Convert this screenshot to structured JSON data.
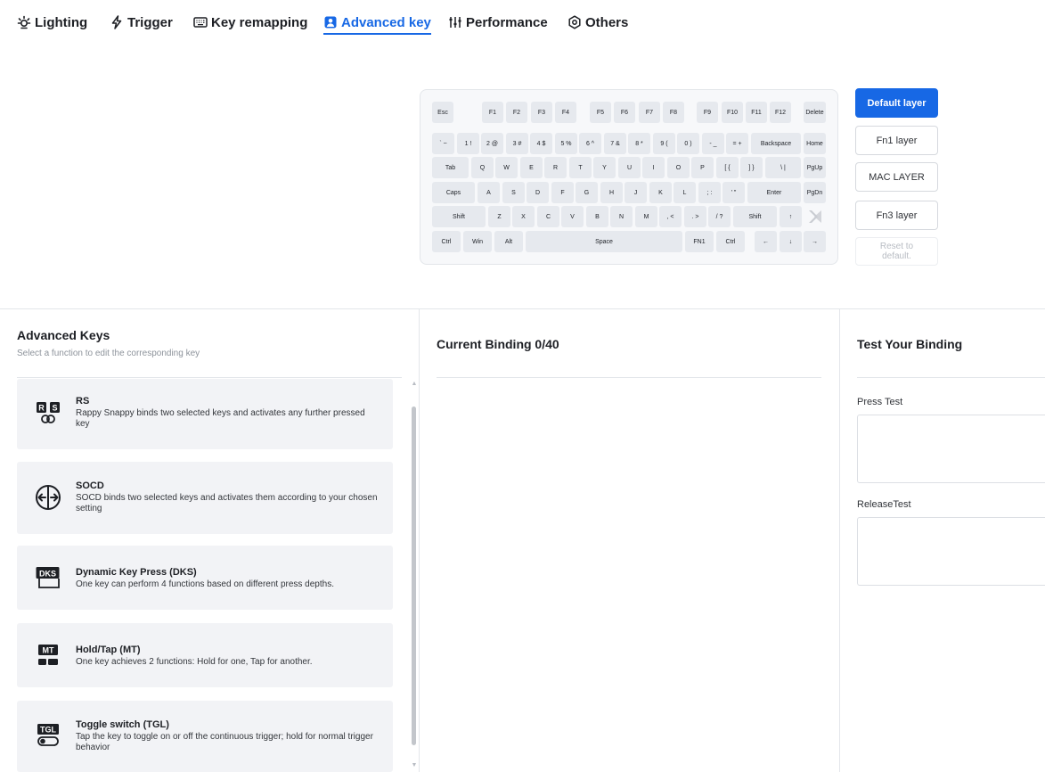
{
  "nav": {
    "tabs": [
      {
        "label": "Lighting",
        "icon": "sun-icon"
      },
      {
        "label": "Trigger",
        "icon": "lightning-icon"
      },
      {
        "label": "Key remapping",
        "icon": "keyboard-icon"
      },
      {
        "label": "Advanced key",
        "icon": "user-card-icon",
        "active": true
      },
      {
        "label": "Performance",
        "icon": "sliders-icon"
      },
      {
        "label": "Others",
        "icon": "hexagon-settings-icon"
      }
    ]
  },
  "keyboard": {
    "rows": [
      [
        "Esc",
        "F1",
        "F2",
        "F3",
        "F4",
        "F5",
        "F6",
        "F7",
        "F8",
        "F9",
        "F10",
        "F11",
        "F12",
        "Delete"
      ],
      [
        "` ~",
        "1 !",
        "2 @",
        "3 #",
        "4 $",
        "5 %",
        "6 ^",
        "7 &",
        "8 *",
        "9 (",
        "0 )",
        "- _",
        "= +",
        "Backspace",
        "Home"
      ],
      [
        "Tab",
        "Q",
        "W",
        "E",
        "R",
        "T",
        "Y",
        "U",
        "I",
        "O",
        "P",
        "[ {",
        "] }",
        "\\ |",
        "PgUp"
      ],
      [
        "Caps",
        "A",
        "S",
        "D",
        "F",
        "G",
        "H",
        "J",
        "K",
        "L",
        "; :",
        "' \"",
        "Enter",
        "PgDn"
      ],
      [
        "Shift",
        "Z",
        "X",
        "C",
        "V",
        "B",
        "N",
        "M",
        ", <",
        ". >",
        "/ ?",
        "Shift",
        "↑",
        ""
      ],
      [
        "Ctrl",
        "Win",
        "Alt",
        "Space",
        "FN1",
        "Ctrl",
        "←",
        "↓",
        "→"
      ]
    ]
  },
  "layers": {
    "buttons": [
      "Default layer",
      "Fn1 layer",
      "MAC LAYER",
      "Fn3 layer"
    ],
    "reset_label": "Reset to default."
  },
  "advanced": {
    "title": "Advanced Keys",
    "subtitle": "Select a function to edit the corresponding key",
    "items": [
      {
        "title": "RS",
        "desc": "Rappy Snappy binds two selected keys and activates any further pressed key",
        "icon": "rs-icon"
      },
      {
        "title": "SOCD",
        "desc": "SOCD binds two selected keys and activates them according to your chosen setting",
        "icon": "socd-arrows-icon"
      },
      {
        "title": "Dynamic Key Press (DKS)",
        "desc": "One key can perform 4 functions based on different press depths.",
        "icon": "dks-icon"
      },
      {
        "title": "Hold/Tap (MT)",
        "desc": "One key achieves 2 functions: Hold for one, Tap for another.",
        "icon": "mt-icon"
      },
      {
        "title": "Toggle switch (TGL)",
        "desc": "Tap the key to toggle on or off the continuous trigger; hold for normal trigger behavior",
        "icon": "tgl-icon"
      }
    ]
  },
  "binding": {
    "title": "Current Binding 0/40"
  },
  "test": {
    "title": "Test Your Binding",
    "press_label": "Press Test",
    "release_label": "ReleaseTest"
  },
  "colors": {
    "accent": "#1768e5",
    "key": "#e6e9ee",
    "card": "#f2f3f6"
  }
}
